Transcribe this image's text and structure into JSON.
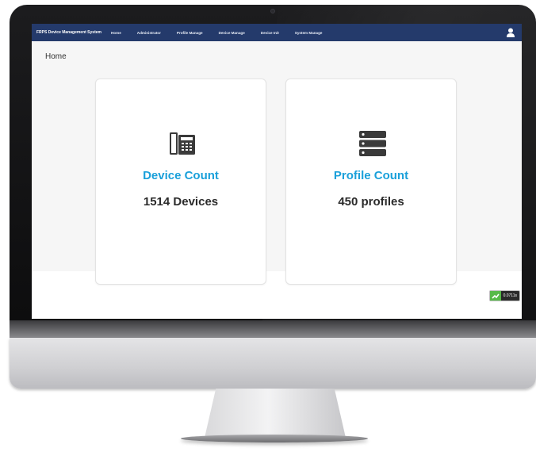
{
  "navbar": {
    "brand": "FRPS Device Management System",
    "items": [
      "Home",
      "Administrator",
      "Profile Manage",
      "Device Manage",
      "Device Init",
      "System Manage"
    ],
    "user_icon": "user-icon"
  },
  "breadcrumb": "Home",
  "cards": [
    {
      "icon": "desk-phone-icon",
      "title": "Device Count",
      "value": "1514 Devices"
    },
    {
      "icon": "server-stack-icon",
      "title": "Profile Count",
      "value": "450 profiles"
    }
  ],
  "debug_timer": {
    "value": "0.0711s",
    "icon": "timer-logo-icon"
  },
  "colors": {
    "navbar_bg": "#243a6b",
    "accent": "#1aa0da",
    "value_text": "#2b2b2b",
    "page_bg": "#f6f6f6"
  }
}
